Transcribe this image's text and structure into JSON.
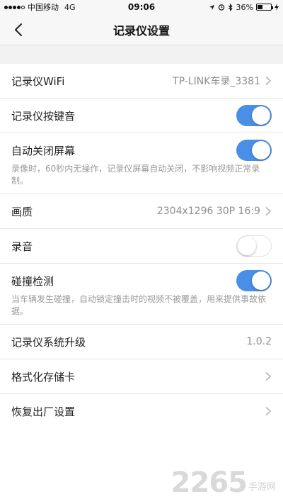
{
  "status_bar": {
    "carrier": "中国移动",
    "network": "4G",
    "time": "09:06",
    "battery": "36%",
    "battery_level": 0.36
  },
  "nav": {
    "title": "记录仪设置",
    "back_icon": "chevron-left-icon"
  },
  "settings": {
    "wifi": {
      "label": "记录仪WiFi",
      "value": "TP-LINK车录_3381"
    },
    "key_sound": {
      "label": "记录仪按键音",
      "enabled": true
    },
    "auto_screen_off": {
      "label": "自动关闭屏幕",
      "enabled": true,
      "description": "录像时，60秒内无操作，记录仪屏幕自动关闭，不影响视频正常录制。"
    },
    "quality": {
      "label": "画质",
      "value": "2304x1296 30P 16:9"
    },
    "audio": {
      "label": "录音",
      "enabled": false
    },
    "collision": {
      "label": "碰撞检测",
      "enabled": true,
      "description": "当车辆发生碰撞，自动锁定撞击时的视频不被覆盖，用来提供事故依据。"
    },
    "firmware": {
      "label": "记录仪系统升级",
      "value": "1.0.2"
    },
    "format_sd": {
      "label": "格式化存储卡"
    },
    "factory_reset": {
      "label": "恢复出厂设置"
    }
  },
  "watermark": {
    "number": "2265",
    "text": "手游网"
  },
  "colors": {
    "accent": "#4a8fe7",
    "background": "#f2f2f2",
    "nav": "#f7f7f7"
  }
}
